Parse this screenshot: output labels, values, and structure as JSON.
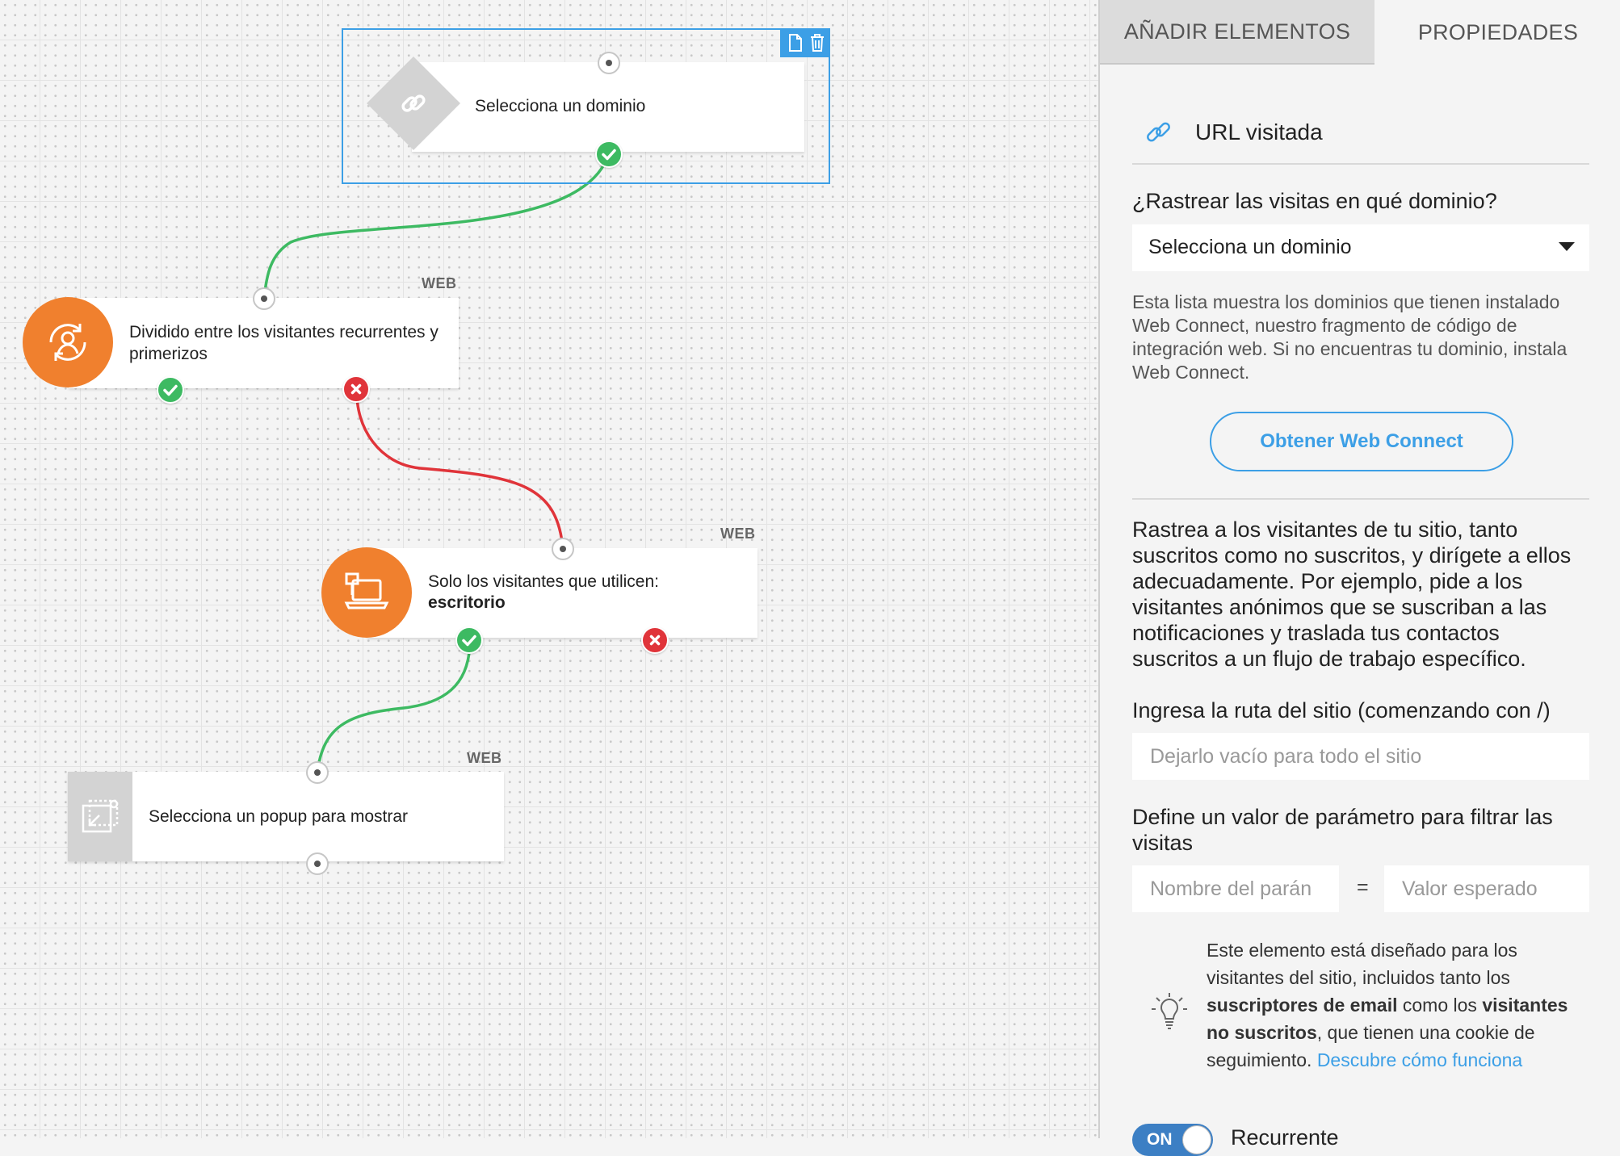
{
  "canvas": {
    "nodes": {
      "domain": {
        "label": "Selecciona un dominio"
      },
      "split": {
        "tag": "WEB",
        "label": "Dividido entre los visitantes recurrentes y primerizos"
      },
      "device": {
        "tag": "WEB",
        "label": "Solo los visitantes que utilicen:",
        "value": "escritorio"
      },
      "popup": {
        "tag": "WEB",
        "label": "Selecciona un popup para mostrar"
      }
    },
    "colors": {
      "success": "#3dba62",
      "failure": "#e0343a",
      "accent": "#f0802e",
      "selection": "#3c9fe6"
    }
  },
  "panel": {
    "tabs": [
      {
        "label": "AÑADIR ELEMENTOS",
        "active": true
      },
      {
        "label": "PROPIEDADES",
        "active": false
      }
    ],
    "element_title": "URL visitada",
    "domain_question": "¿Rastrear las visitas en qué dominio?",
    "domain_select_value": "Selecciona un dominio",
    "domain_help": "Esta lista muestra los dominios que tienen instalado Web Connect, nuestro fragmento de código de integración web. Si no encuentras tu dominio, instala Web Connect.",
    "get_web_connect_button": "Obtener Web Connect",
    "description": "Rastrea a los visitantes de tu sitio, tanto suscritos como no suscritos, y dirígete a ellos adecuadamente. Por ejemplo, pide a los visitantes anónimos que se suscriban a las notificaciones y traslada tus contactos suscritos a un flujo de trabajo específico.",
    "path_label": "Ingresa la ruta del sitio (comenzando con /)",
    "path_placeholder": "Dejarlo vacío para todo el sitio",
    "param_label": "Define un valor de parámetro para filtrar las visitas",
    "param_name_placeholder": "Nombre del parán",
    "param_equals": "=",
    "param_value_placeholder": "Valor esperado",
    "tip": {
      "part1": "Este elemento está diseñado para los visitantes del sitio, incluidos tanto los ",
      "bold1": "suscriptores de email",
      "part2": " como los ",
      "bold2": "visitantes no suscritos",
      "part3": ", que tienen una cookie de seguimiento. ",
      "link": "Descubre cómo funciona"
    },
    "toggle_state": "ON",
    "toggle_label": "Recurrente"
  }
}
